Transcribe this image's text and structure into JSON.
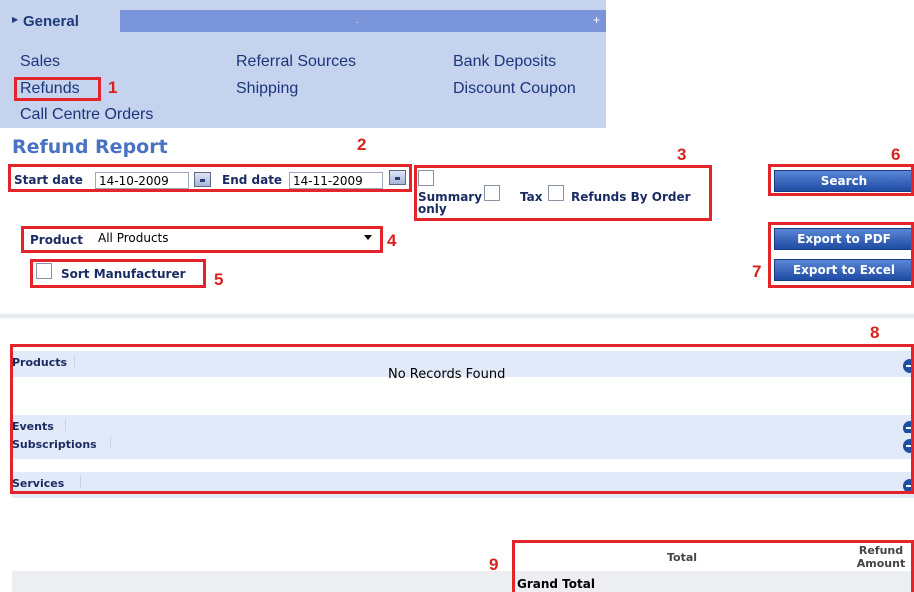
{
  "nav": {
    "header_title": "General",
    "header_dot": ".",
    "header_plus": "+",
    "links": [
      {
        "label": "Sales"
      },
      {
        "label": "Referral Sources"
      },
      {
        "label": "Bank Deposits"
      },
      {
        "label": "Refunds"
      },
      {
        "label": "Shipping"
      },
      {
        "label": "Discount Coupon"
      },
      {
        "label": "Call Centre Orders"
      }
    ]
  },
  "page": {
    "title": "Refund Report"
  },
  "filters": {
    "start_date_label": "Start date",
    "start_date_value": "14-10-2009",
    "end_date_label": "End date",
    "end_date_value": "14-11-2009",
    "summary_label_line1": "Summary",
    "summary_label_line2": "only",
    "tax_label": "Tax",
    "refunds_by_order_label": "Refunds By Order",
    "product_label": "Product",
    "product_value": "All Products",
    "sort_manufacturer_label": "Sort Manufacturer"
  },
  "buttons": {
    "search": "Search",
    "export_pdf": "Export to PDF",
    "export_excel": "Export to Excel"
  },
  "sections": [
    {
      "label": "Products"
    },
    {
      "label": "Events"
    },
    {
      "label": "Subscriptions"
    },
    {
      "label": "Services"
    }
  ],
  "no_records_text": "No Records Found",
  "totals": {
    "total_header": "Total",
    "refund_header_line1": "Refund",
    "refund_header_line2": "Amount",
    "grand_total_label": "Grand Total"
  },
  "callouts": [
    "1",
    "2",
    "3",
    "4",
    "5",
    "6",
    "7",
    "8",
    "9"
  ],
  "colors": {
    "nav_background": "#c5d3ef",
    "nav_header_bar": "#7b95db",
    "title_blue": "#4a72c2",
    "annotation_red": "#e3252b",
    "button_blue": "#1d4ba3",
    "section_row": "#e2e9f8"
  }
}
